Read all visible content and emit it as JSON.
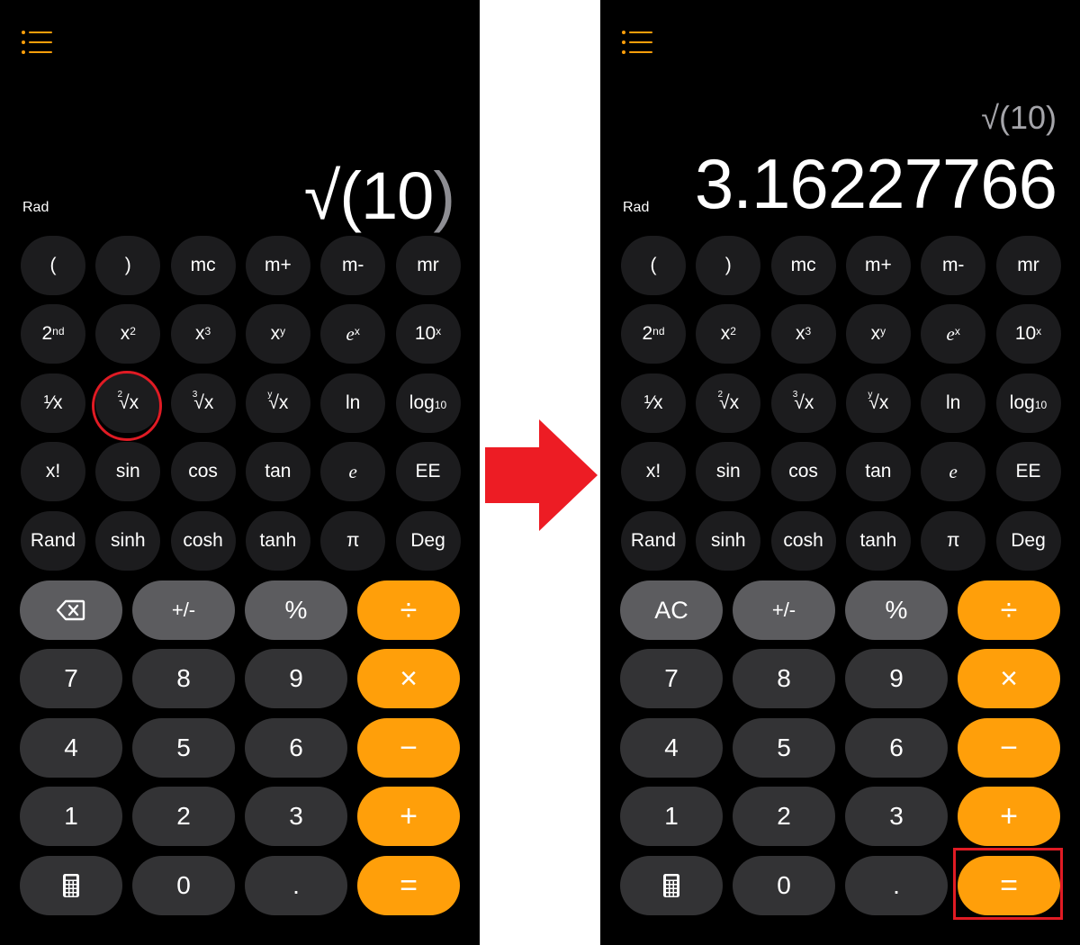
{
  "colors": {
    "background": "#000000",
    "accent": "#ff9f0a",
    "sci_button": "#1c1c1e",
    "num_button": "#333335",
    "fn_button": "#5c5c5f",
    "annotation": "#e01b24",
    "separator": "#ffffff"
  },
  "before": {
    "mode_label": "Rad",
    "expression": "√(10",
    "expression_closing": ")",
    "clear_label": "⌫"
  },
  "after": {
    "mode_label": "Rad",
    "expression": "√(10)",
    "result": "3.16227766",
    "clear_label": "AC"
  },
  "scientific_rows": [
    [
      "(",
      ")",
      "mc",
      "m+",
      "m-",
      "mr"
    ],
    [
      "2nd",
      "x²",
      "x³",
      "xʸ",
      "eˣ",
      "10ˣ"
    ],
    [
      "¹⁄x",
      "²√x",
      "³√x",
      "ʸ√x",
      "ln",
      "log₁₀"
    ],
    [
      "x!",
      "sin",
      "cos",
      "tan",
      "e",
      "EE"
    ],
    [
      "Rand",
      "sinh",
      "cosh",
      "tanh",
      "π",
      "Deg"
    ]
  ],
  "keypad": {
    "fn": [
      "+/-",
      "%"
    ],
    "digits": [
      [
        "7",
        "8",
        "9"
      ],
      [
        "4",
        "5",
        "6"
      ],
      [
        "1",
        "2",
        "3"
      ]
    ],
    "bottom": [
      "0",
      "."
    ],
    "operators": [
      "÷",
      "×",
      "−",
      "+",
      "="
    ]
  },
  "icons": {
    "menu": "list-icon",
    "backspace": "backspace-icon",
    "calculator": "calculator-icon",
    "arrow": "arrow-right-icon"
  }
}
